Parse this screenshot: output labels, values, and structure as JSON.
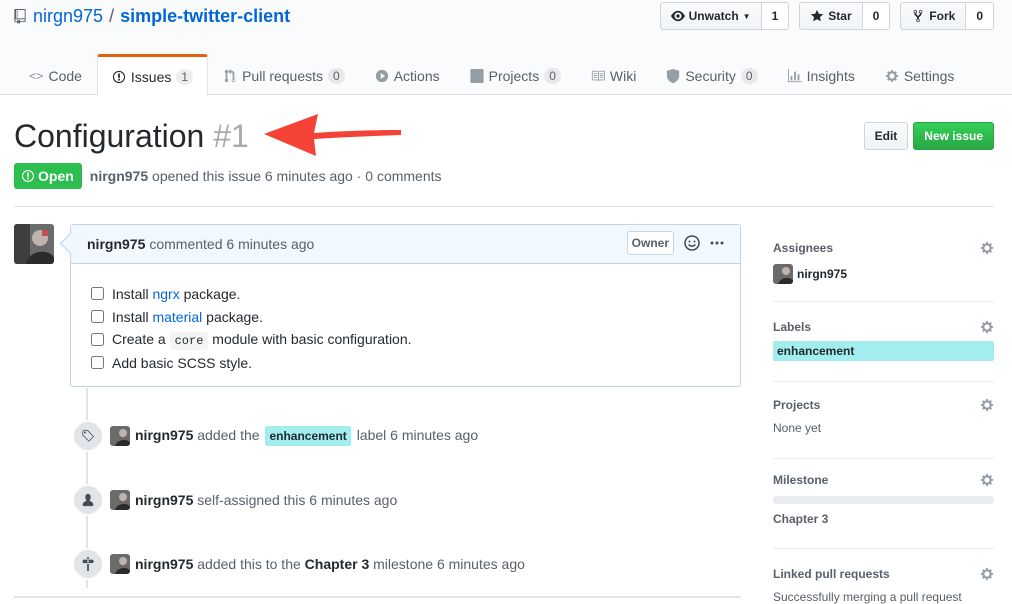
{
  "repo": {
    "owner": "nirgn975",
    "separator": "/",
    "name": "simple-twitter-client"
  },
  "actions": {
    "watch": {
      "label": "Unwatch",
      "count": "1"
    },
    "star": {
      "label": "Star",
      "count": "0"
    },
    "fork": {
      "label": "Fork",
      "count": "0"
    }
  },
  "nav": {
    "code": "Code",
    "issues": {
      "label": "Issues",
      "count": "1"
    },
    "pulls": {
      "label": "Pull requests",
      "count": "0"
    },
    "actions": "Actions",
    "projects": {
      "label": "Projects",
      "count": "0"
    },
    "wiki": "Wiki",
    "security": {
      "label": "Security",
      "count": "0"
    },
    "insights": "Insights",
    "settings": "Settings"
  },
  "issue": {
    "title": "Configuration",
    "number": "#1",
    "state": "Open",
    "author": "nirgn975",
    "meta_text": "opened this issue 6 minutes ago · 0 comments",
    "edit_label": "Edit",
    "new_issue_label": "New issue"
  },
  "comment": {
    "author": "nirgn975",
    "action": "commented 6 minutes ago",
    "owner_label": "Owner",
    "tasks": [
      {
        "pre": "Install ",
        "link": "ngrx",
        "post": " package.",
        "checked": false
      },
      {
        "pre": "Install ",
        "link": "material",
        "post": " package.",
        "checked": false
      },
      {
        "pre": "Create a ",
        "code": "core",
        "post": " module with basic configuration.",
        "checked": false
      },
      {
        "pre": "Add basic SCSS style.",
        "checked": false
      }
    ]
  },
  "timeline": [
    {
      "author": "nirgn975",
      "pre": "added the",
      "label": "enhancement",
      "post": "label 6 minutes ago",
      "icon": "tag-icon"
    },
    {
      "author": "nirgn975",
      "pre": "self-assigned this 6 minutes ago",
      "icon": "person-icon"
    },
    {
      "author": "nirgn975",
      "pre": "added this to the",
      "strong": "Chapter 3",
      "post": "milestone 6 minutes ago",
      "icon": "milestone-icon"
    }
  ],
  "sidebar": {
    "assignees": {
      "heading": "Assignees",
      "value": "nirgn975"
    },
    "labels": {
      "heading": "Labels",
      "value": "enhancement"
    },
    "projects": {
      "heading": "Projects",
      "value": "None yet"
    },
    "milestone": {
      "heading": "Milestone",
      "value": "Chapter 3",
      "progress": 0
    },
    "linked": {
      "heading": "Linked pull requests",
      "value": "Successfully merging a pull request"
    }
  },
  "colors": {
    "link": "#0366d6",
    "open_green": "#2cbe4e",
    "label_bg": "#a2eeef",
    "arrow": "#f44336"
  }
}
